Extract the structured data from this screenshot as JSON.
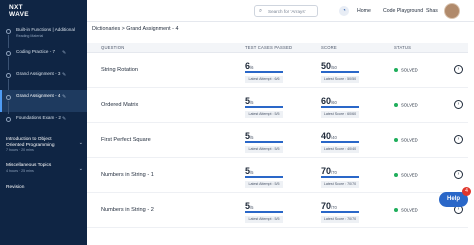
{
  "brand": {
    "logo_line1": "NXT",
    "logo_line2": "WAVE"
  },
  "sidebar": {
    "items": [
      {
        "title": "Built-in Functions | Additional",
        "meta": "Reading Material",
        "active": false
      },
      {
        "title": "Coding Practice - 7",
        "meta": "",
        "active": false
      },
      {
        "title": "Grand Assignment - 3",
        "meta": "",
        "active": false
      },
      {
        "title": "Grand Assignment - 4",
        "meta": "",
        "active": true
      },
      {
        "title": "Foundations Exam - 2",
        "meta": "",
        "active": false
      }
    ],
    "sections": [
      {
        "title": "Introduction to Object",
        "title2": "Oriented Programming",
        "meta": "7 hours · 20 mins"
      },
      {
        "title": "Miscellaneous Topics",
        "title2": "",
        "meta": "4 hours · 25 mins"
      },
      {
        "title": "Revision",
        "title2": "",
        "meta": ""
      }
    ]
  },
  "header": {
    "search_placeholder": "Search for 'Arrays'",
    "streak_icon": "streak-icon",
    "nav_home": "Home",
    "nav_code_playground": "Code Playground",
    "user_name": "Shas"
  },
  "breadcrumb": "Dictionaries > Grand Assignment - 4",
  "table": {
    "headers": {
      "question": "QUESTION",
      "test_cases": "TEST CASES PASSED",
      "score": "SCORE",
      "status": "STATUS"
    },
    "rows": [
      {
        "question": "String Rotation",
        "passed": "6",
        "total": "/6",
        "latest_attempt": "Latest Attempt : 6/6",
        "score": "50",
        "score_total": "/50",
        "latest_score": "Latest Score : 50/50",
        "status": "SOLVED"
      },
      {
        "question": "Ordered Matrix",
        "passed": "5",
        "total": "/5",
        "latest_attempt": "Latest Attempt : 5/5",
        "score": "60",
        "score_total": "/60",
        "latest_score": "Latest Score : 60/60",
        "status": "SOLVED"
      },
      {
        "question": "First Perfect Square",
        "passed": "5",
        "total": "/5",
        "latest_attempt": "Latest Attempt : 5/5",
        "score": "40",
        "score_total": "/40",
        "latest_score": "Latest Score : 40/40",
        "status": "SOLVED"
      },
      {
        "question": "Numbers in String - 1",
        "passed": "5",
        "total": "/5",
        "latest_attempt": "Latest Attempt : 5/5",
        "score": "70",
        "score_total": "/70",
        "latest_score": "Latest Score : 70/70",
        "status": "SOLVED"
      },
      {
        "question": "Numbers in String - 2",
        "passed": "5",
        "total": "/5",
        "latest_attempt": "Latest Attempt : 5/5",
        "score": "70",
        "score_total": "/70",
        "latest_score": "Latest Score : 70/70",
        "status": "SOLVED"
      }
    ]
  },
  "help": {
    "label": "Help",
    "badge": "4"
  },
  "colors": {
    "sidebar_bg": "#0f2544",
    "accent": "#2a67c8",
    "solved": "#1fae5b",
    "badge": "#e0352b"
  }
}
